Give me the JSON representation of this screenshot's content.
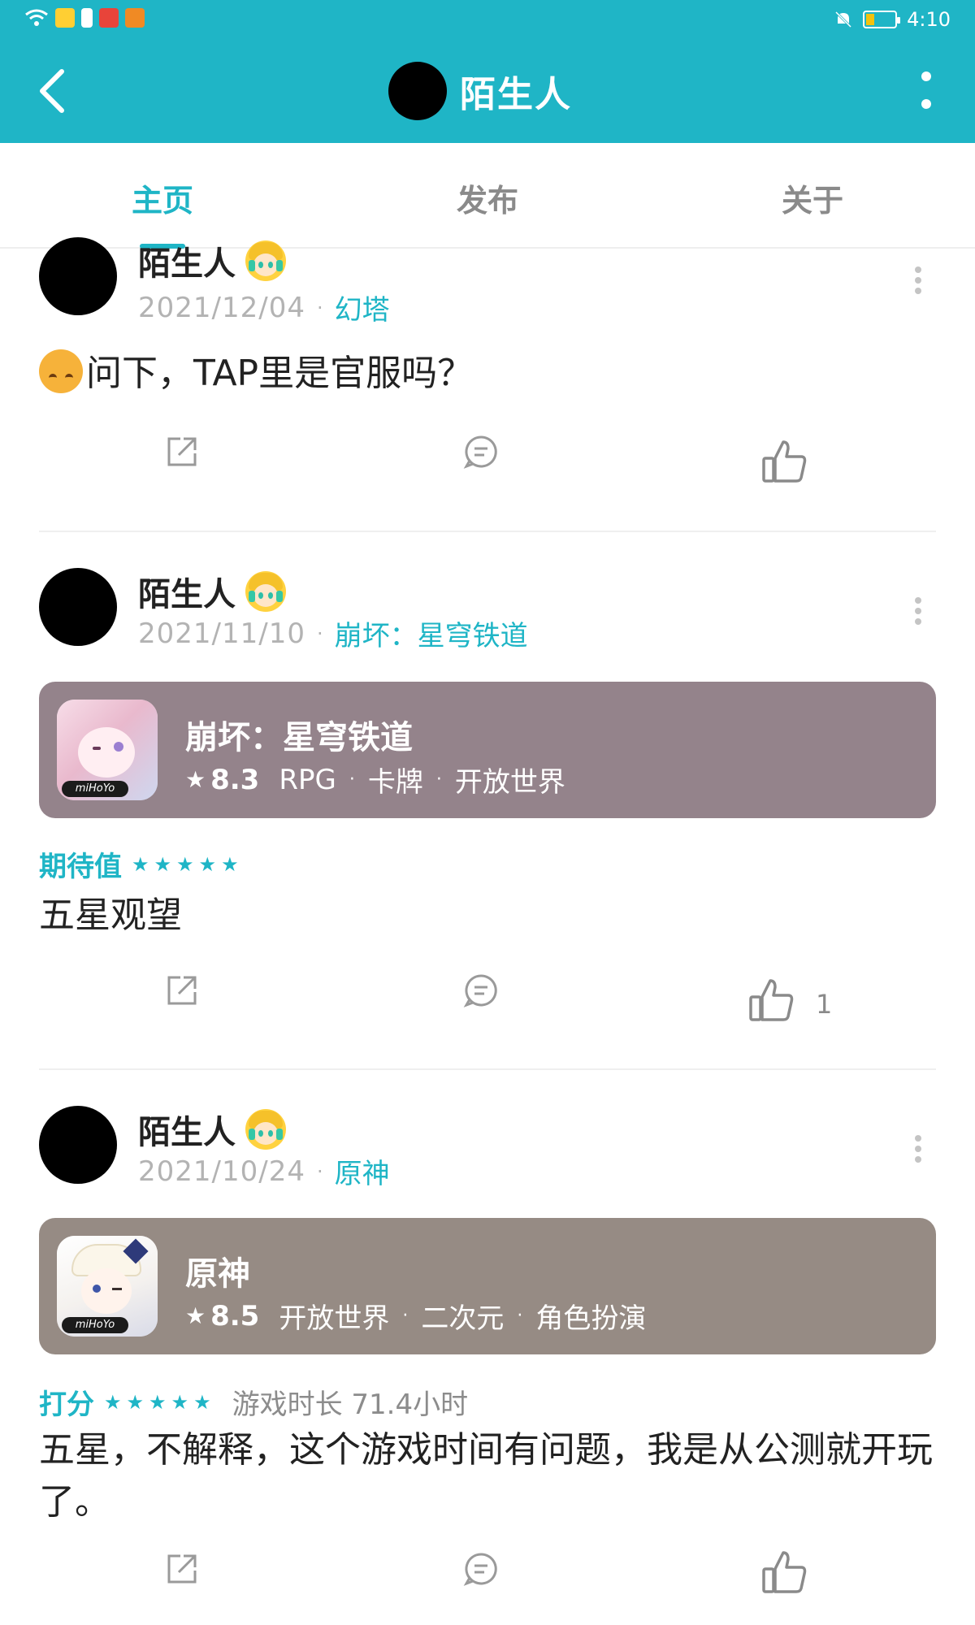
{
  "status_bar": {
    "time": "4:10"
  },
  "header": {
    "title": "陌生人"
  },
  "tabs": [
    {
      "label": "主页",
      "active": true
    },
    {
      "label": "发布",
      "active": false
    },
    {
      "label": "关于",
      "active": false
    }
  ],
  "posts": [
    {
      "user_name": "陌生人",
      "date": "2021/12/04",
      "game": "幻塔",
      "text": "问下，TAP里是官服吗？",
      "emoji": "upside-down-face-emoji",
      "like_count": ""
    },
    {
      "user_name": "陌生人",
      "date": "2021/11/10",
      "game": "崩坏：星穹铁道",
      "card": {
        "title": "崩坏：星穹铁道",
        "score": "8.3",
        "tags": [
          "RPG",
          "卡牌",
          "开放世界"
        ],
        "logo": "miHoYo",
        "color": "#94838b"
      },
      "rating_label": "期待值",
      "stars": "★★★★★",
      "text": "五星观望",
      "like_count": "1"
    },
    {
      "user_name": "陌生人",
      "date": "2021/10/24",
      "game": "原神",
      "card": {
        "title": "原神",
        "score": "8.5",
        "tags": [
          "开放世界",
          "二次元",
          "角色扮演"
        ],
        "logo": "miHoYo",
        "color": "#968b84"
      },
      "rating_label": "打分",
      "stars": "★★★★★",
      "playtime": "游戏时长 71.4小时",
      "text": "五星，不解释，这个游戏时间有问题，我是从公测就开玩了。",
      "like_count": ""
    }
  ],
  "colors": {
    "accent": "#1fb5c6",
    "header_bg": "#1fb5c6"
  }
}
